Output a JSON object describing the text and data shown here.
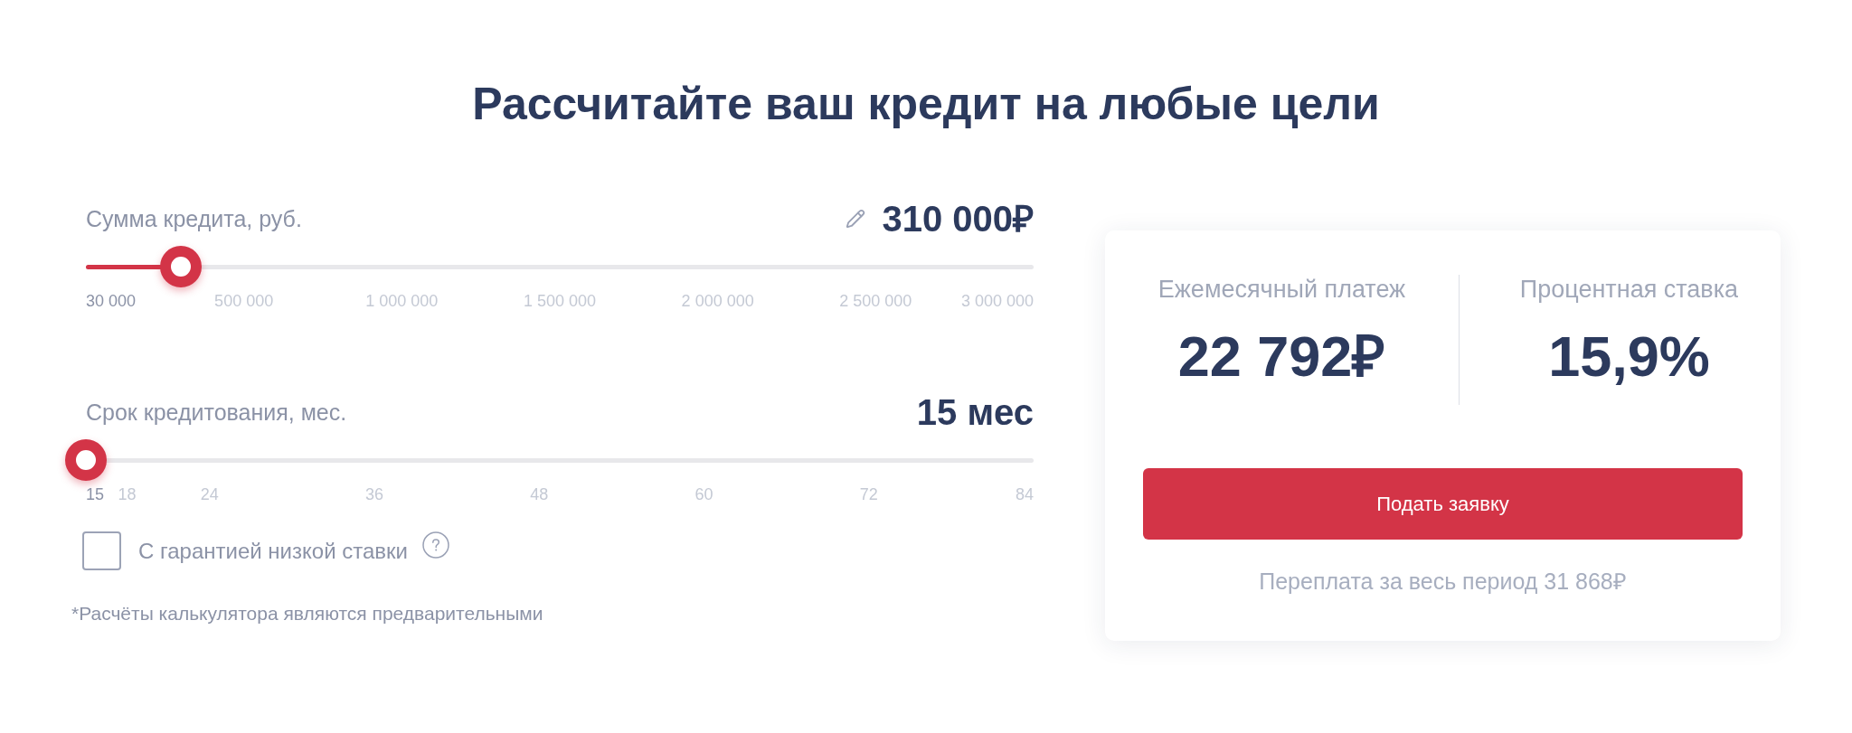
{
  "title": "Рассчитайте ваш кредит на любые цели",
  "sliders": [
    {
      "kind": "even",
      "label": "Сумма кредита, руб.",
      "value": "310 000₽",
      "editable": true,
      "level": 0.1,
      "ticks": [
        {
          "label": "30 000",
          "active": true
        },
        {
          "label": "500 000",
          "active": false
        },
        {
          "label": "1 000 000",
          "active": false
        },
        {
          "label": "1 500 000",
          "active": false
        },
        {
          "label": "2 000 000",
          "active": false
        },
        {
          "label": "2 500 000",
          "active": false
        },
        {
          "label": "3 000 000",
          "active": false
        }
      ]
    },
    {
      "kind": "linear",
      "label": "Срок кредитования, мес.",
      "value": "15 мес",
      "editable": false,
      "level": 0,
      "ticks": [
        {
          "label": "15",
          "active": true
        },
        {
          "label": "18",
          "active": false
        },
        {
          "label": "24",
          "active": false
        },
        {
          "label": "36",
          "active": false
        },
        {
          "label": "48",
          "active": false
        },
        {
          "label": "60",
          "active": false
        },
        {
          "label": "72",
          "active": false
        },
        {
          "label": "84",
          "active": false
        }
      ]
    }
  ],
  "guarantee": {
    "label": "С гарантией низкой ставки",
    "checked": false
  },
  "note": "*Расчёты калькулятора являются предварительными",
  "summary": {
    "stats": [
      {
        "label": "Ежемесячный платеж",
        "value": "22 792₽"
      },
      {
        "label": "Процентная ставка",
        "value": "15,9%"
      }
    ],
    "button": "Подать заявку",
    "overpayment": "Переплата за весь период 31 868₽"
  }
}
